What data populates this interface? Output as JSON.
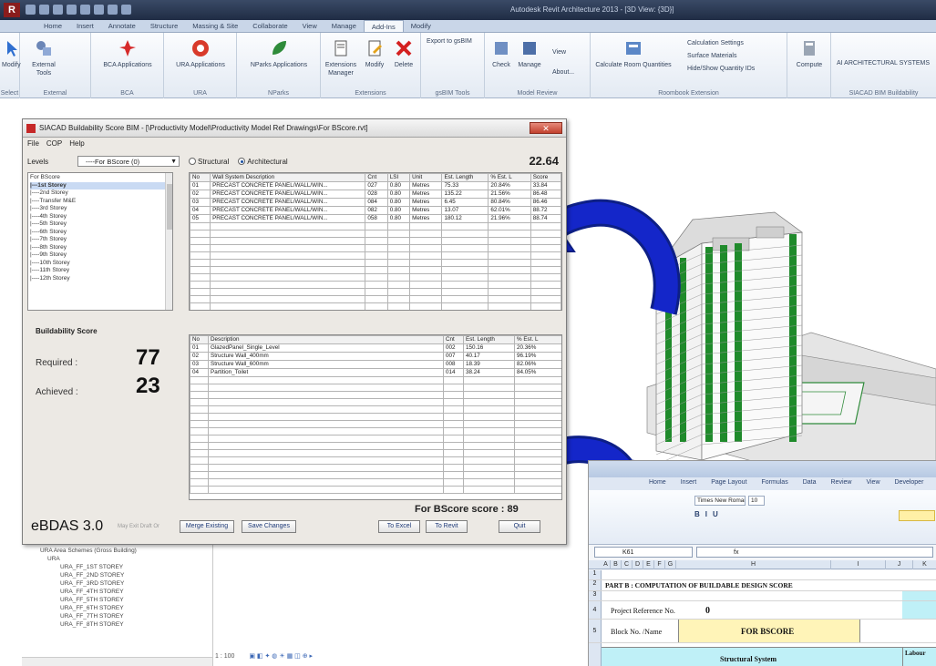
{
  "revit": {
    "logo": "R",
    "title": "Autodesk Revit Architecture 2013 - [3D View: {3D}]",
    "tabs": [
      "Home",
      "Insert",
      "Annotate",
      "Structure",
      "Massing & Site",
      "Collaborate",
      "View",
      "Manage",
      "Add-Ins",
      "Modify"
    ],
    "active_tab": "Add-Ins",
    "groups": [
      {
        "label": "Select",
        "buttons": [
          "Modify"
        ]
      },
      {
        "label": "External",
        "buttons": [
          "External Tools"
        ]
      },
      {
        "label": "BCA",
        "buttons": [
          "BCA Applications"
        ]
      },
      {
        "label": "URA",
        "buttons": [
          "URA Applications"
        ]
      },
      {
        "label": "NParks",
        "buttons": [
          "NParks Applications"
        ]
      },
      {
        "label": "Extensions",
        "buttons": [
          "Extensions Manager",
          "Modify",
          "Delete"
        ]
      },
      {
        "label": "gsBIM Tools",
        "buttons": [
          "Export to gsBIM"
        ]
      },
      {
        "label": "Model Review",
        "buttons": [
          "Check",
          "Manage",
          "View",
          "About..."
        ]
      },
      {
        "label": "Roombook Extension",
        "buttons": [
          "Calculate Room Quantities"
        ]
      },
      {
        "label": "",
        "buttons": [
          "Compute"
        ]
      },
      {
        "label": "SIACAD BIM Buildability",
        "buttons": [
          "AI ARCHITECTURAL SYSTEMS"
        ]
      }
    ],
    "room_small": [
      "Calculation Settings",
      "Surface Materials",
      "Hide/Show Quantity IDs"
    ]
  },
  "dialog": {
    "title": "SIACAD Buildability Score BIM - [\\Productivity Model\\Productivity Model Ref Drawings\\For BScore.rvt]",
    "close": "✕",
    "menu": [
      "File",
      "COP",
      "Help"
    ],
    "levels_label": "Levels",
    "levels_value": "----For BScore (0)",
    "radio_structural": "Structural",
    "radio_architectural": "Architectural",
    "top_score": "22.64",
    "tree": [
      "For BScore",
      "|---1st Storey",
      "|----2nd Storey",
      "|----Transfer M&E",
      "|----3rd Storey",
      "|----4th Storey",
      "|----5th Storey",
      "|----6th Storey",
      "|----7th Storey",
      "|----8th Storey",
      "|----9th Storey",
      "|----10th Storey",
      "|----11th Storey",
      "|----12th Storey"
    ],
    "wall_table": {
      "headers": [
        "No",
        "Wall System Description",
        "Cnt",
        "LSI",
        "Unit",
        "Est. Length",
        "% Est. L",
        "Score"
      ],
      "rows": [
        [
          "01",
          "PRECAST CONCRETE PANEL/WALL/WIN...",
          "027",
          "0.80",
          "Metres",
          "75.33",
          "20.84%",
          "33.84"
        ],
        [
          "02",
          "PRECAST CONCRETE PANEL/WALL/WIN...",
          "028",
          "0.80",
          "Metres",
          "135.22",
          "21.56%",
          "86.48"
        ],
        [
          "03",
          "PRECAST CONCRETE PANEL/WALL/WIN...",
          "084",
          "0.80",
          "Metres",
          "6.45",
          "80.84%",
          "86.46"
        ],
        [
          "04",
          "PRECAST CONCRETE PANEL/WALL/WIN...",
          "082",
          "0.80",
          "Metres",
          "13.07",
          "62.01%",
          "88.72"
        ],
        [
          "05",
          "PRECAST CONCRETE PANEL/WALL/WIN...",
          "058",
          "0.80",
          "Metres",
          "180.12",
          "21.96%",
          "88.74"
        ]
      ]
    },
    "bscore_title": "Buildability Score",
    "required_label": "Required :",
    "required_value": "77",
    "achieved_label": "Achieved :",
    "achieved_value": "23",
    "comp_table": {
      "headers": [
        "No",
        "Description",
        "Cnt",
        "Est. Length",
        "% Est. L"
      ],
      "rows": [
        [
          "01",
          "GlazedPanel_Single_Level",
          "002",
          "150.16",
          "20.36%"
        ],
        [
          "02",
          "Structure Wall_400mm",
          "007",
          "40.17",
          "96.19%"
        ],
        [
          "03",
          "Structure Wall_600mm",
          "008",
          "18.39",
          "82.06%"
        ],
        [
          "04",
          "Partition_Toilet",
          "014",
          "38.24",
          "84.05%"
        ]
      ]
    },
    "for_bscore": "For BScore  score : 89",
    "brand": "eBDAS 3.0",
    "hint": "May Exit Draft Or",
    "buttons": [
      "Merge Existing",
      "Save Changes",
      "To Excel",
      "To Revit",
      "Quit"
    ]
  },
  "explorer": {
    "items": [
      "URA Area Schemes (Gross Building)",
      "URA",
      "URA_FF_1ST STOREY",
      "URA_FF_2ND STOREY",
      "URA_FF_3RD STOREY",
      "URA_FF_4TH STOREY",
      "URA_FF_5TH STOREY",
      "URA_FF_6TH STOREY",
      "URA_FF_7TH STOREY",
      "URA_FF_8TH STOREY"
    ],
    "status": "1 : 100"
  },
  "excel": {
    "tabs": [
      "Home",
      "Insert",
      "Page Layout",
      "Formulas",
      "Data",
      "Review",
      "View",
      "Developer"
    ],
    "font_name": "Times New Roman",
    "font_size": "10",
    "cell_ref": "K61",
    "fx": "fx",
    "columns": [
      "A",
      "B",
      "C",
      "D",
      "E",
      "F",
      "G",
      "H",
      "I",
      "J",
      "K"
    ],
    "heading": "PART B : COMPUTATION OF BUILDABLE DESIGN SCORE",
    "project_ref_label": "Project Reference No.",
    "project_ref_value": "0",
    "block_label": "Block No. /Name",
    "block_value": "FOR BSCORE",
    "structural_label": "Structural System",
    "right_label": "Labour"
  },
  "colors": {
    "arrow": "#1426c9",
    "facade_green": "#1f8a2b",
    "ribbon_blue": "#c9d6e8",
    "highlight_yellow": "#fff4b8",
    "excel_cyan": "#bff0f7"
  }
}
